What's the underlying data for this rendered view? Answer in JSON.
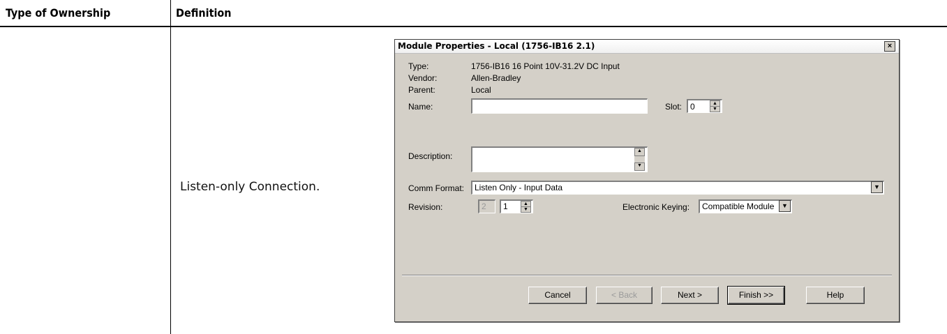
{
  "table": {
    "headers": [
      "Type of Ownership",
      "Definition"
    ],
    "row_text": "Listen-only Connection."
  },
  "dialog": {
    "title": "Module Properties - Local (1756-IB16 2.1)",
    "close": "×",
    "type_label": "Type:",
    "type_value": "1756-IB16 16 Point 10V-31.2V DC Input",
    "vendor_label": "Vendor:",
    "vendor_value": "Allen-Bradley",
    "parent_label": "Parent:",
    "parent_value": "Local",
    "name_label": "Name:",
    "name_value": "",
    "slot_label": "Slot:",
    "slot_value": "0",
    "description_label": "Description:",
    "description_value": "",
    "comm_format_label": "Comm Format:",
    "comm_format_value": "Listen Only - Input Data",
    "revision_label": "Revision:",
    "revision_major": "2",
    "revision_minor": "1",
    "keying_label": "Electronic Keying:",
    "keying_value": "Compatible Module",
    "buttons": {
      "cancel": "Cancel",
      "back": "< Back",
      "next": "Next >",
      "finish": "Finish >>",
      "help": "Help"
    }
  }
}
